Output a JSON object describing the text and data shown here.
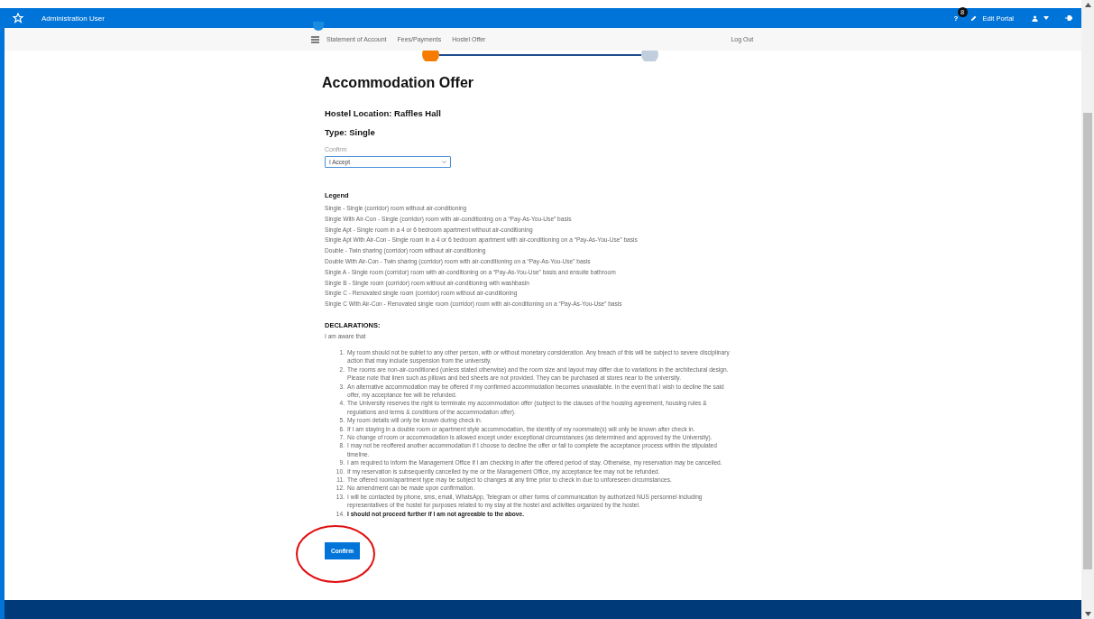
{
  "header": {
    "title": "Administration User",
    "help_label": "?",
    "help_badge": "8",
    "edit_portal": "Edit Portal"
  },
  "nav": {
    "items": [
      "Statement of Account",
      "Fees/Payments",
      "Hostel Offer"
    ],
    "logout": "Log Out"
  },
  "stepper": [
    {
      "selected": true
    },
    {
      "selected": false
    }
  ],
  "heading": "Accommodation Offer",
  "location": "Hostel Location: Raffles Hall",
  "type": "Type: Single",
  "confirm_field": {
    "label": "Confirm",
    "value": "I Accept"
  },
  "legend": {
    "title": "Legend",
    "items": [
      "Single - Single (corridor) room without air-conditioning",
      "Single With Air-Con - Single (corridor) room with air-conditioning on a “Pay-As-You-Use” basis",
      "Single Apt - Single room in a 4 or 6 bedroom apartment without air-conditioning",
      "Single Apt With Air-Con - Single room in a 4 or 6 bedroom apartment with air-conditioning on a “Pay-As-You-Use” basis",
      "Double - Twin sharing (corridor) room without air-conditioning",
      "Double With Air-Con - Twin sharing (corridor) room with air-conditioning on a “Pay-As-You-Use” basis",
      "Single A - Single room (corridor) room with air-conditioning on a “Pay-As-You-Use” basis and ensuite bathroom",
      "Single B - Single room (corridor) room without air-conditioning with washbasin",
      "Single C - Renovated single room (corridor) room without air-conditioning",
      "Single C With Air-Con - Renovated single room (corridor) room with air-conditioning on a “Pay-As-You-Use” basis"
    ]
  },
  "declarations": {
    "title": "DECLARATIONS:",
    "intro": "I am aware that",
    "items": [
      {
        "number": "1.",
        "text": "My room should not be sublet to any other person, with or without monetary consideration. Any breach of this will be subject to severe disciplinary action that may include suspension from the university.",
        "bold": false
      },
      {
        "number": "2.",
        "text": "The rooms are non-air-conditioned (unless stated otherwise) and the room size and layout may differ due to variations in the architectural design. Please note that linen such as pillows and bed sheets are not provided. They can be purchased at stores near to the university.",
        "bold": false
      },
      {
        "number": "3.",
        "text": "An alternative accommodation may be offered if my confirmed accommodation becomes unavailable. In the event that I wish to decline the said offer, my acceptance fee will be refunded.",
        "bold": false
      },
      {
        "number": "4.",
        "text": "The University reserves the right to terminate my accommodation offer (subject to the clauses of the housing agreement, housing rules & regulations and terms & conditions of the accommodation offer).",
        "bold": false
      },
      {
        "number": "5.",
        "text": "My room details will only be known during check in.",
        "bold": false
      },
      {
        "number": "6.",
        "text": "If I am staying in a double room or apartment style accommodation, the identity of my roommate(s) will only be known after check in.",
        "bold": false
      },
      {
        "number": "7.",
        "text": "No change of room or accommodation is allowed except under exceptional circumstances (as determined and approved by the University).",
        "bold": false
      },
      {
        "number": "8.",
        "text": "I may not be reoffered another accommodation if I choose to decline the offer or fail to complete the acceptance process within the stipulated timeline.",
        "bold": false
      },
      {
        "number": "9.",
        "text": "I am required to inform the Management Office if I am checking in after the offered period of stay. Otherwise, my reservation may be cancelled.",
        "bold": false
      },
      {
        "number": "10.",
        "text": "If my reservation is subsequently cancelled by me or the Management Office, my acceptance fee may not be refunded.",
        "bold": false
      },
      {
        "number": "11.",
        "text": "The offered room/apartment type may be subject to changes at any time prior to check in due to unforeseen circumstances.",
        "bold": false
      },
      {
        "number": "12.",
        "text": "No amendment can be made upon confirmation.",
        "bold": false
      },
      {
        "number": "13.",
        "text": "I will be contacted by phone, sms, email, WhatsApp, Telegram or other forms of communication by authorized NUS personnel including representatives of the hostel for purposes related to my stay at the hostel and activities organized by the hostel.",
        "bold": false
      },
      {
        "number": "14.",
        "text": "I should not proceed further if I am not agreeable to the above.",
        "bold": true
      }
    ]
  },
  "confirm_button": "Confirm"
}
